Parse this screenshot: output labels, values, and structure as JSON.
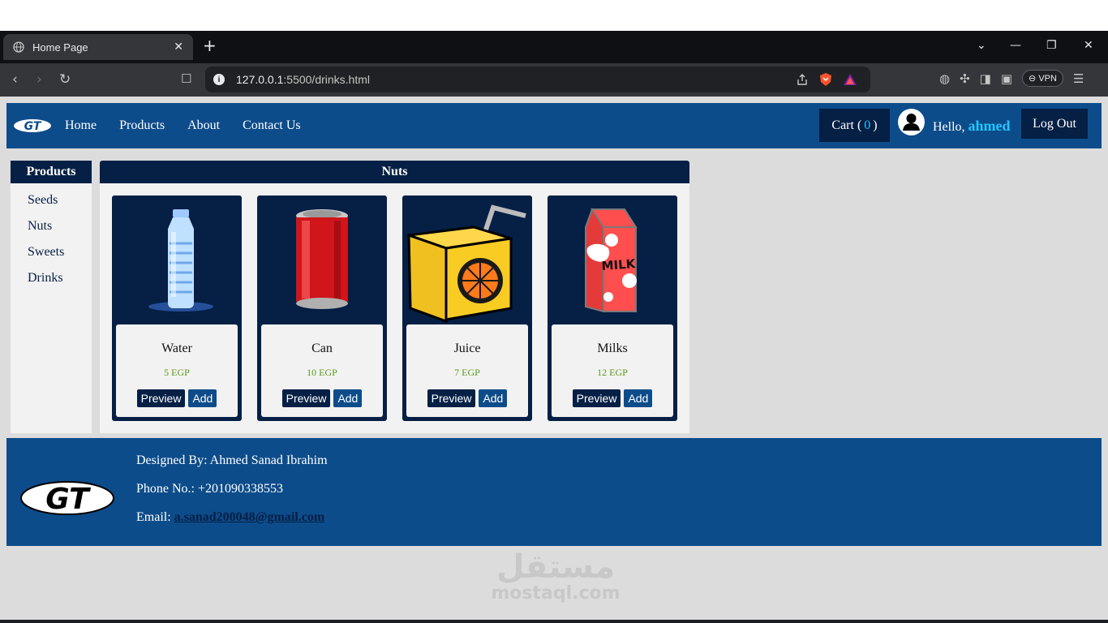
{
  "browser": {
    "tab_title": "Home Page",
    "new_tab": "+",
    "close_tab": "✕",
    "url_host": "127.0.0.1",
    "url_rest": ":5500/drinks.html",
    "vpn_label": "VPN"
  },
  "navbar": {
    "links": [
      "Home",
      "Products",
      "About",
      "Contact Us"
    ],
    "cart_label": "Cart (",
    "cart_count": "0",
    "cart_close": ")",
    "hello_label": "Hello,",
    "username": "ahmed",
    "logout_label": "Log Out"
  },
  "sidebar": {
    "title": "Products",
    "items": [
      "Seeds",
      "Nuts",
      "Sweets",
      "Drinks"
    ]
  },
  "content": {
    "title": "Nuts",
    "products": [
      {
        "name": "Water",
        "price": "5 EGP",
        "preview": "Preview",
        "add": "Add",
        "icon": "water-bottle"
      },
      {
        "name": "Can",
        "price": "10 EGP",
        "preview": "Preview",
        "add": "Add",
        "icon": "soda-can"
      },
      {
        "name": "Juice",
        "price": "7 EGP",
        "preview": "Preview",
        "add": "Add",
        "icon": "juice-box"
      },
      {
        "name": "Milks",
        "price": "12 EGP",
        "preview": "Preview",
        "add": "Add",
        "icon": "milk-carton"
      }
    ]
  },
  "footer": {
    "designed_by": "Designed By: Ahmed Sanad Ibrahim",
    "phone": "Phone No.: +201090338553",
    "email_label": "Email:",
    "email": "a.sanad200048@gmail.com"
  },
  "watermark": {
    "arabic": "مستقل",
    "latin": "mostaql.com"
  },
  "colors": {
    "nav_blue": "#0d4c8a",
    "dark_navy": "#051f45",
    "accent_cyan": "#25c6ff",
    "price_green": "#5a9a1a"
  }
}
